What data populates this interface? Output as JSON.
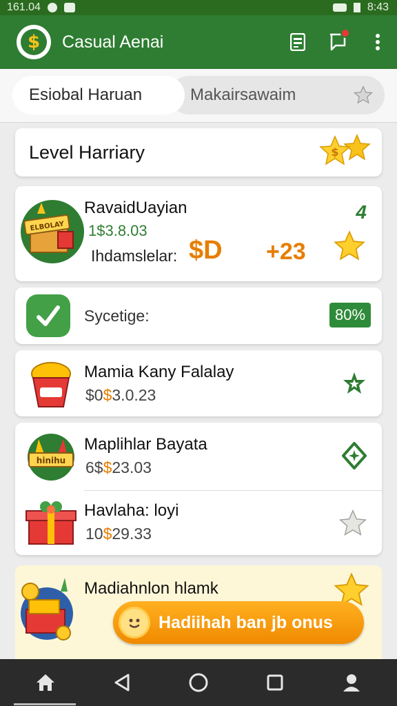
{
  "status_bar": {
    "time_left": "161.04",
    "time_right": "8:43"
  },
  "app_bar": {
    "logo_glyph": "$",
    "title": "Casual Aenai",
    "icons": [
      "receipt-icon",
      "chat-notification-icon",
      "more-vert-icon"
    ]
  },
  "tabs": [
    {
      "label": "Esiobal Haruan",
      "active": true
    },
    {
      "label": "Makairsawaim",
      "active": false
    }
  ],
  "level_card": {
    "title": "Level Harriary"
  },
  "reward_card": {
    "name": "RavaidUayian",
    "amount": "1$3.8.03",
    "sub_label": "Ihdamslelar:",
    "big_value": "$D",
    "plus_value": "+23",
    "tag": "4",
    "box_label": "ELBOLAY"
  },
  "sync_card": {
    "label": "Sycetige:",
    "percent": "80%"
  },
  "items": [
    {
      "name": "Mamia Kany Falalay",
      "price_prefix": "$0",
      "price_mid": "$",
      "price_rest": "3.0.23"
    },
    {
      "name": "Maplihlar Bayata",
      "price_prefix": "6$",
      "price_mid": "$",
      "price_rest": "23.03",
      "badge_label": "hinihu"
    },
    {
      "name": "Havlaha: loyi",
      "price_prefix": "10",
      "price_mid": "$",
      "price_rest": "29.33"
    }
  ],
  "promo": {
    "title": "Madiahnlon hlamk",
    "button_label": "Hadiihah ban jb onus"
  },
  "colors": {
    "primary_green": "#2e7d32",
    "accent_orange": "#f08a00",
    "star_gold": "#f7c21a"
  }
}
